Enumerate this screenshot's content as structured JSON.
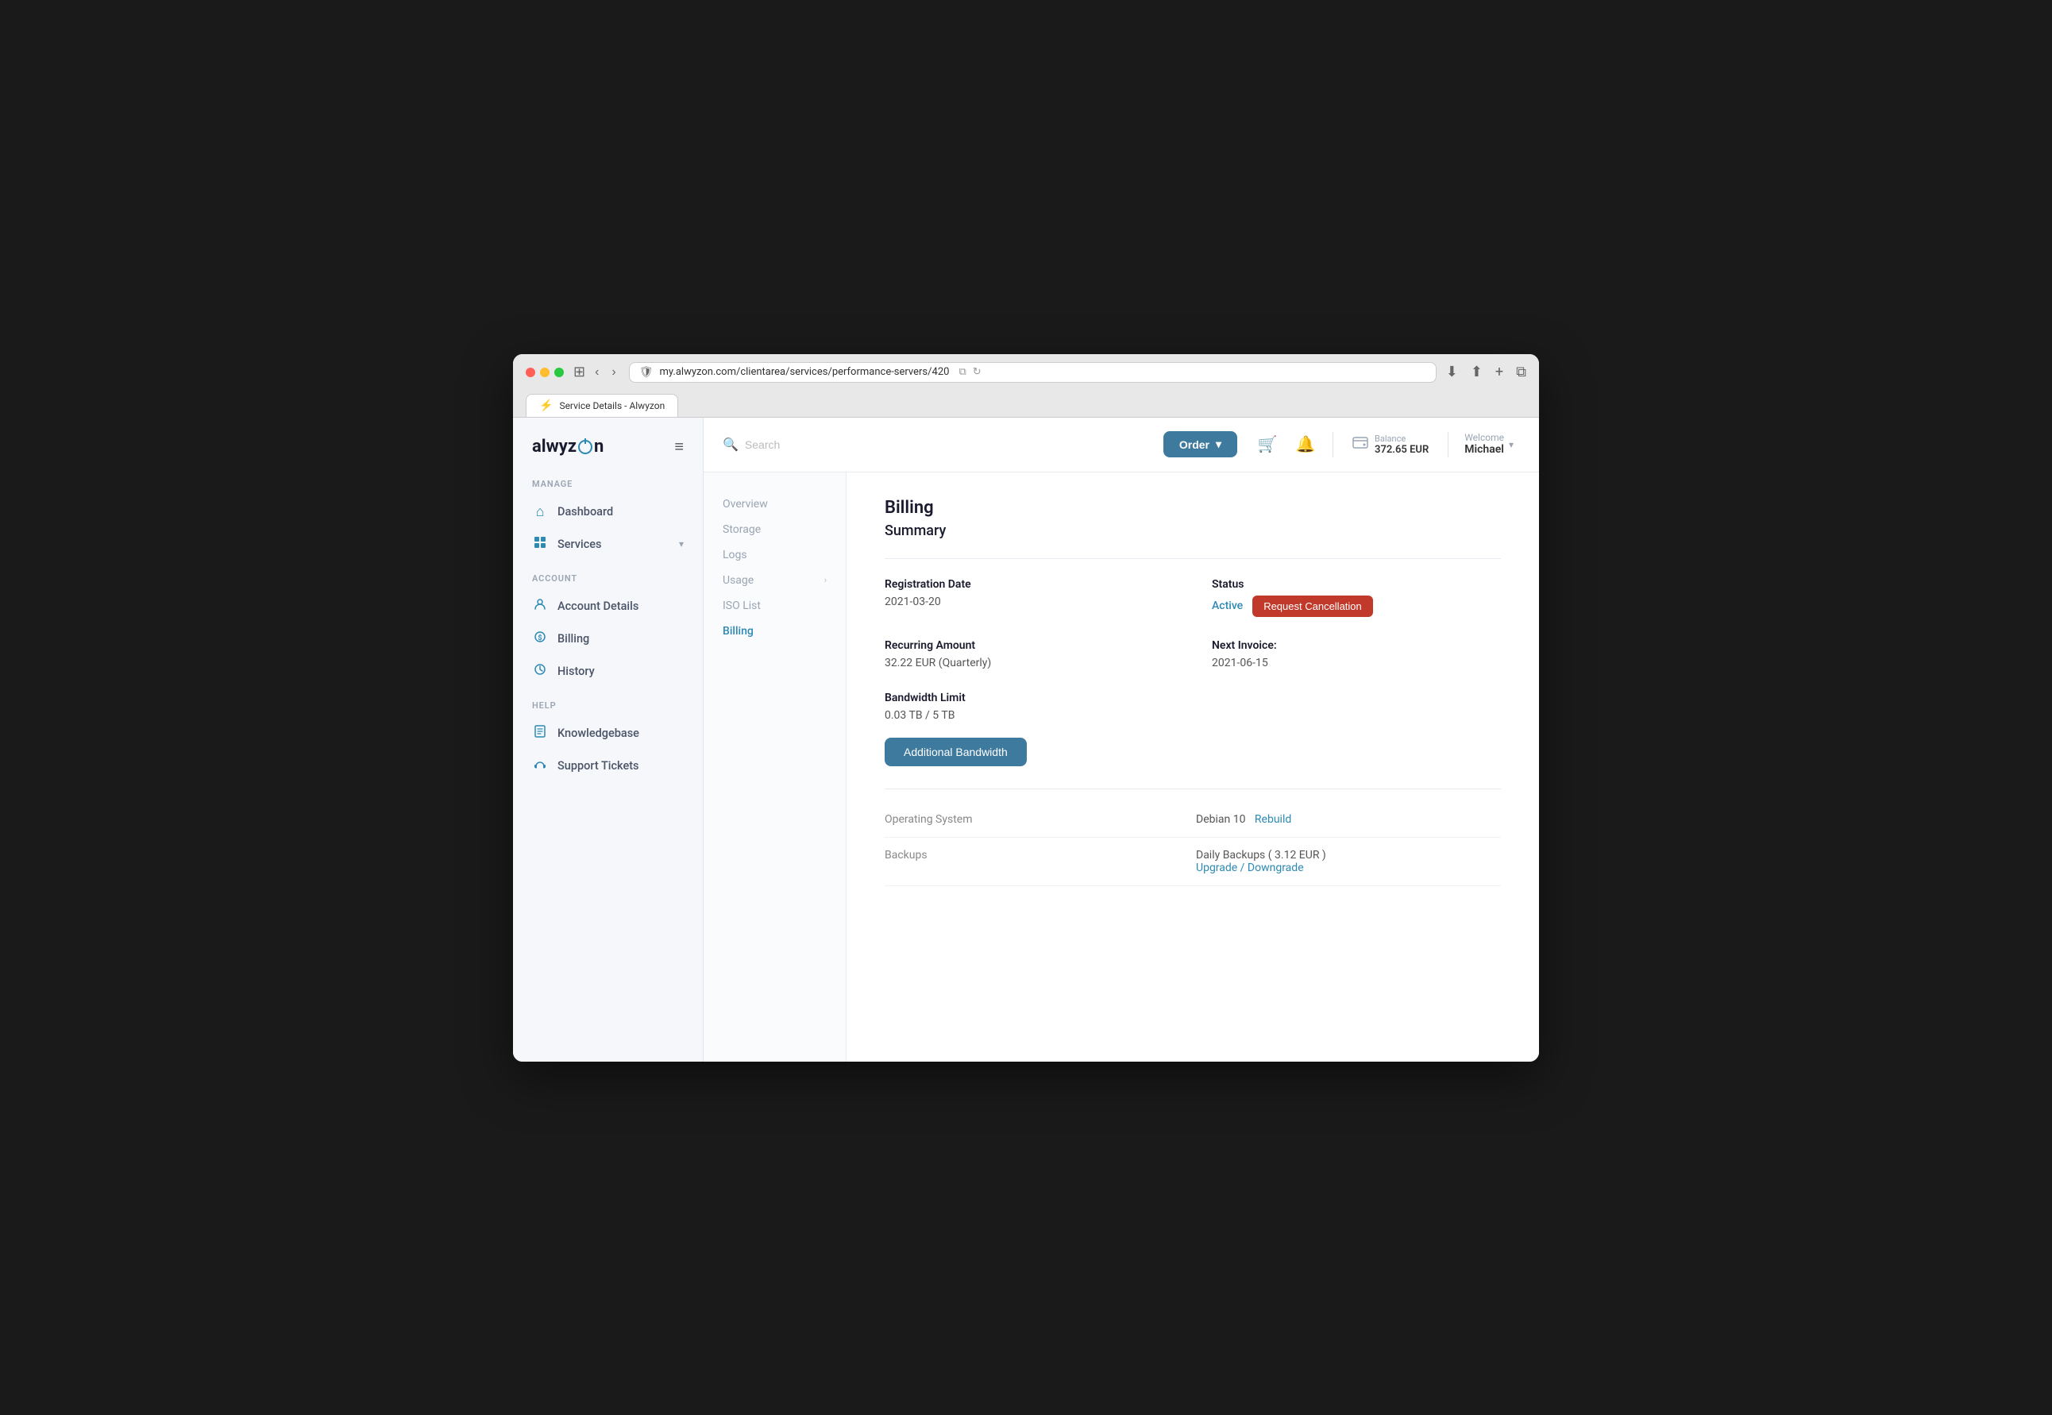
{
  "browser": {
    "tab_title": "Service Details - Alwyzon",
    "url": "my.alwyzon.com/clientarea/services/performance-servers/420",
    "favicon": "⚡"
  },
  "sidebar": {
    "logo": "alwyzon",
    "sections": [
      {
        "label": "MANAGE",
        "items": [
          {
            "id": "dashboard",
            "label": "Dashboard",
            "icon": "🏠"
          },
          {
            "id": "services",
            "label": "Services",
            "icon": "👤",
            "hasChevron": true
          }
        ]
      },
      {
        "label": "ACCOUNT",
        "items": [
          {
            "id": "account-details",
            "label": "Account Details",
            "icon": "👤"
          },
          {
            "id": "billing",
            "label": "Billing",
            "icon": "💲"
          },
          {
            "id": "history",
            "label": "History",
            "icon": "🕐"
          }
        ]
      },
      {
        "label": "HELP",
        "items": [
          {
            "id": "knowledgebase",
            "label": "Knowledgebase",
            "icon": "📄"
          },
          {
            "id": "support-tickets",
            "label": "Support Tickets",
            "icon": "🔔"
          }
        ]
      }
    ]
  },
  "header": {
    "search_placeholder": "Search",
    "order_label": "Order",
    "balance_label": "Balance",
    "balance_amount": "372.65 EUR",
    "welcome_label": "Welcome",
    "welcome_name": "Michael"
  },
  "sub_nav": {
    "items": [
      {
        "id": "overview",
        "label": "Overview"
      },
      {
        "id": "storage",
        "label": "Storage"
      },
      {
        "id": "logs",
        "label": "Logs"
      },
      {
        "id": "usage",
        "label": "Usage",
        "hasChevron": true
      },
      {
        "id": "iso-list",
        "label": "ISO List"
      },
      {
        "id": "billing",
        "label": "Billing",
        "active": true
      }
    ]
  },
  "main": {
    "page_title": "Billing",
    "section_title": "Summary",
    "fields": {
      "registration_date_label": "Registration Date",
      "registration_date_value": "2021-03-20",
      "status_label": "Status",
      "status_value": "Active",
      "cancel_btn_label": "Request Cancellation",
      "recurring_amount_label": "Recurring Amount",
      "recurring_amount_value": "32.22 EUR (Quarterly)",
      "next_invoice_label": "Next Invoice:",
      "next_invoice_value": "2021-06-15",
      "bandwidth_limit_label": "Bandwidth Limit",
      "bandwidth_limit_value": "0.03 TB / 5 TB",
      "additional_bandwidth_label": "Additional Bandwidth",
      "os_label": "Operating System",
      "os_value": "Debian 10",
      "os_link": "Rebuild",
      "backups_label": "Backups",
      "backups_value": "Daily Backups ( 3.12 EUR )",
      "backups_link": "Upgrade / Downgrade"
    }
  }
}
